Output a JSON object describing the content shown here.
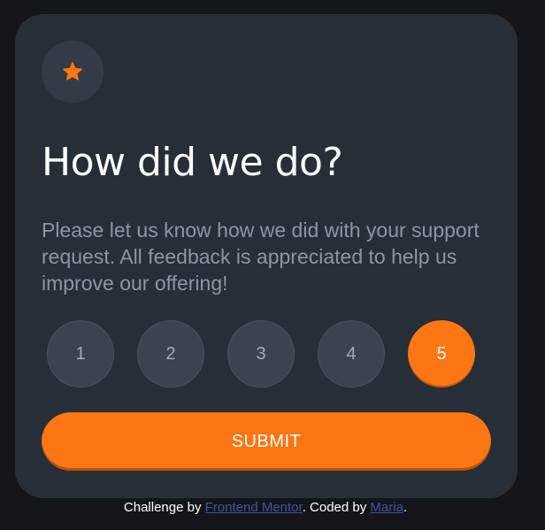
{
  "card": {
    "icon": "star-icon",
    "title": "How did we do?",
    "description": "Please let us know how we did with your support request. All feedback is appreciated to help us improve our offering!"
  },
  "ratings": {
    "options": [
      "1",
      "2",
      "3",
      "4",
      "5"
    ],
    "selected": "5"
  },
  "submit": {
    "label": "SUBMIT"
  },
  "attribution": {
    "prefix": "Challenge by",
    "link1": "Frontend Mentor",
    "middle": ". Coded by",
    "link2": "Maria",
    "suffix": "."
  },
  "colors": {
    "background": "#131518",
    "card": "#262e38",
    "accent": "#fc7613",
    "rating_bg": "#3b4350",
    "text_muted": "#8b96a6",
    "link": "#3e52a3"
  }
}
